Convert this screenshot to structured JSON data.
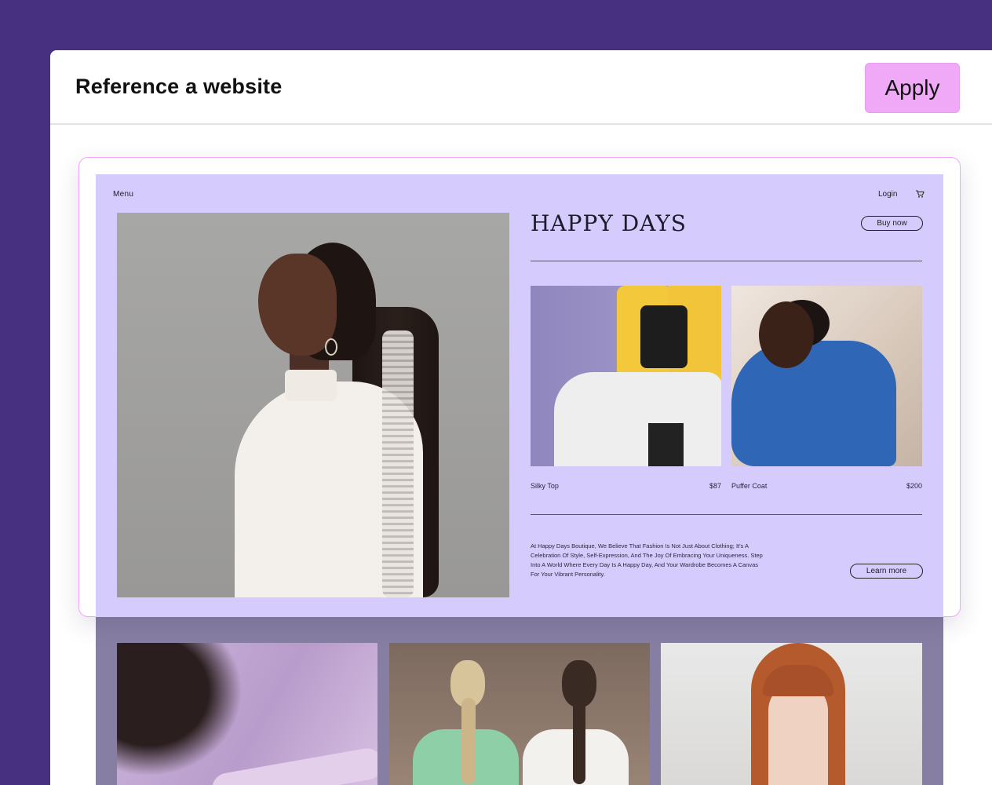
{
  "panel": {
    "title": "Reference a website",
    "apply_label": "Apply"
  },
  "site": {
    "menu_label": "Menu",
    "login_label": "Login",
    "cart_icon": "cart-icon",
    "title": "HAPPY DAYS",
    "buy_label": "Buy now",
    "products": [
      {
        "name": "Silky Top",
        "price": "$87"
      },
      {
        "name": "Puffer Coat",
        "price": "$200"
      }
    ],
    "about": "At Happy Days Boutique, We Believe That Fashion Is Not Just About Clothing; It's A Celebration Of Style, Self-Expression, And The Joy Of Embracing Your Uniqueness. Step Into A World Where Every Day Is A Happy Day, And Your Wardrobe Becomes A Canvas For Your Vibrant Personality.",
    "learn_label": "Learn more"
  },
  "colors": {
    "background": "#47307f",
    "accent": "#efa9f6",
    "site_background": "#d5ccfd"
  }
}
